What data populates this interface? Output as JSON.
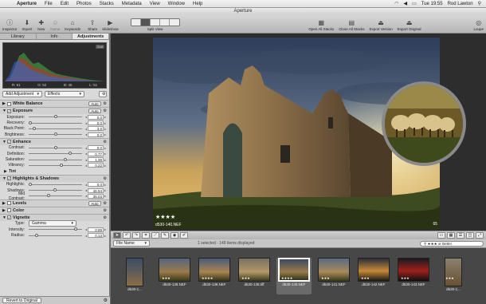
{
  "menubar": {
    "app": "Aperture",
    "items": [
      "File",
      "Edit",
      "Photos",
      "Stacks",
      "Metadata",
      "View",
      "Window",
      "Help"
    ],
    "clock": "Tue 19:55",
    "user": "Rod Lawton"
  },
  "window": {
    "title": "Aperture"
  },
  "toolbar": {
    "inspector": "Inspector",
    "import": "Import",
    "new": "New",
    "name": "Name",
    "keywords": "Keywords",
    "share": "Share",
    "slideshow": "Slideshow",
    "split_view": "Split View",
    "open_all_stacks": "Open All Stacks",
    "close_all_stacks": "Close All Stacks",
    "export_version": "Export Version",
    "export_original": "Export Original",
    "loupe": "Loupe"
  },
  "inspector": {
    "tabs": [
      "Library",
      "Info",
      "Adjustments"
    ],
    "active_tab": "Adjustments",
    "histogram": {
      "exif_badge": "Exif",
      "r": "R: 61",
      "g": "G: 52",
      "b": "B: 45",
      "l": "L: 51"
    },
    "add_adjustment": "Add Adjustment",
    "effects": "Effects",
    "sections": {
      "white_balance": {
        "title": "White Balance",
        "auto": "Auto"
      },
      "exposure": {
        "title": "Exposure",
        "auto": "Auto",
        "params": [
          {
            "label": "Exposure:",
            "value": "0.0"
          },
          {
            "label": "Recovery:",
            "value": "0.0"
          },
          {
            "label": "Black Point:",
            "value": "3.0"
          },
          {
            "label": "Brightness:",
            "value": "0.0"
          }
        ]
      },
      "enhance": {
        "title": "Enhance",
        "params": [
          {
            "label": "Contrast:",
            "value": "0.0"
          },
          {
            "label": "Definition:",
            "value": "0.77"
          },
          {
            "label": "Saturation:",
            "value": "1.39"
          },
          {
            "label": "Vibrancy:",
            "value": "0.22"
          }
        ],
        "tint": "Tint"
      },
      "highlights_shadows": {
        "title": "Highlights & Shadows",
        "params": [
          {
            "label": "Highlights:",
            "value": "0.0"
          },
          {
            "label": "Shadows:",
            "value": "46.54"
          },
          {
            "label": "Mid Contrast:",
            "value": "35.03"
          }
        ]
      },
      "levels": {
        "title": "Levels",
        "auto": "Auto"
      },
      "color": {
        "title": "Color"
      },
      "vignette": {
        "title": "Vignette",
        "type_label": "Type:",
        "type_value": "Gamma",
        "params": [
          {
            "label": "Intensity:",
            "value": "0.89"
          },
          {
            "label": "Radius:",
            "value": "0.13"
          }
        ]
      }
    },
    "revert": "Revert to Original"
  },
  "viewer": {
    "rating": "★★★★",
    "filename": "d530-140.NEF",
    "badge": "65"
  },
  "browser": {
    "sort": "File Name",
    "selection_status": "1 selected - 149 items displayed",
    "filter": "★★★ or Better",
    "thumbs": [
      {
        "caption": "d530-1...",
        "stars": "★",
        "type": "portrait"
      },
      {
        "caption": "d530-138.NEF",
        "stars": "★★★",
        "type": "landscape"
      },
      {
        "caption": "d530-138.NEF",
        "stars": "★★★★",
        "type": "landscape"
      },
      {
        "caption": "d530-138.tiff",
        "stars": "★★★",
        "type": "landscape"
      },
      {
        "caption": "d530-140.NEF",
        "stars": "★★★★",
        "type": "landscape",
        "selected": true
      },
      {
        "caption": "d530-141.NEF",
        "stars": "★★★",
        "type": "landscape"
      },
      {
        "caption": "d530-142.NEF",
        "stars": "★★★",
        "type": "landscape"
      },
      {
        "caption": "d530-143.NEF",
        "stars": "★★★",
        "type": "landscape"
      },
      {
        "caption": "d530-1...",
        "stars": "★★★",
        "type": "portrait"
      }
    ]
  }
}
